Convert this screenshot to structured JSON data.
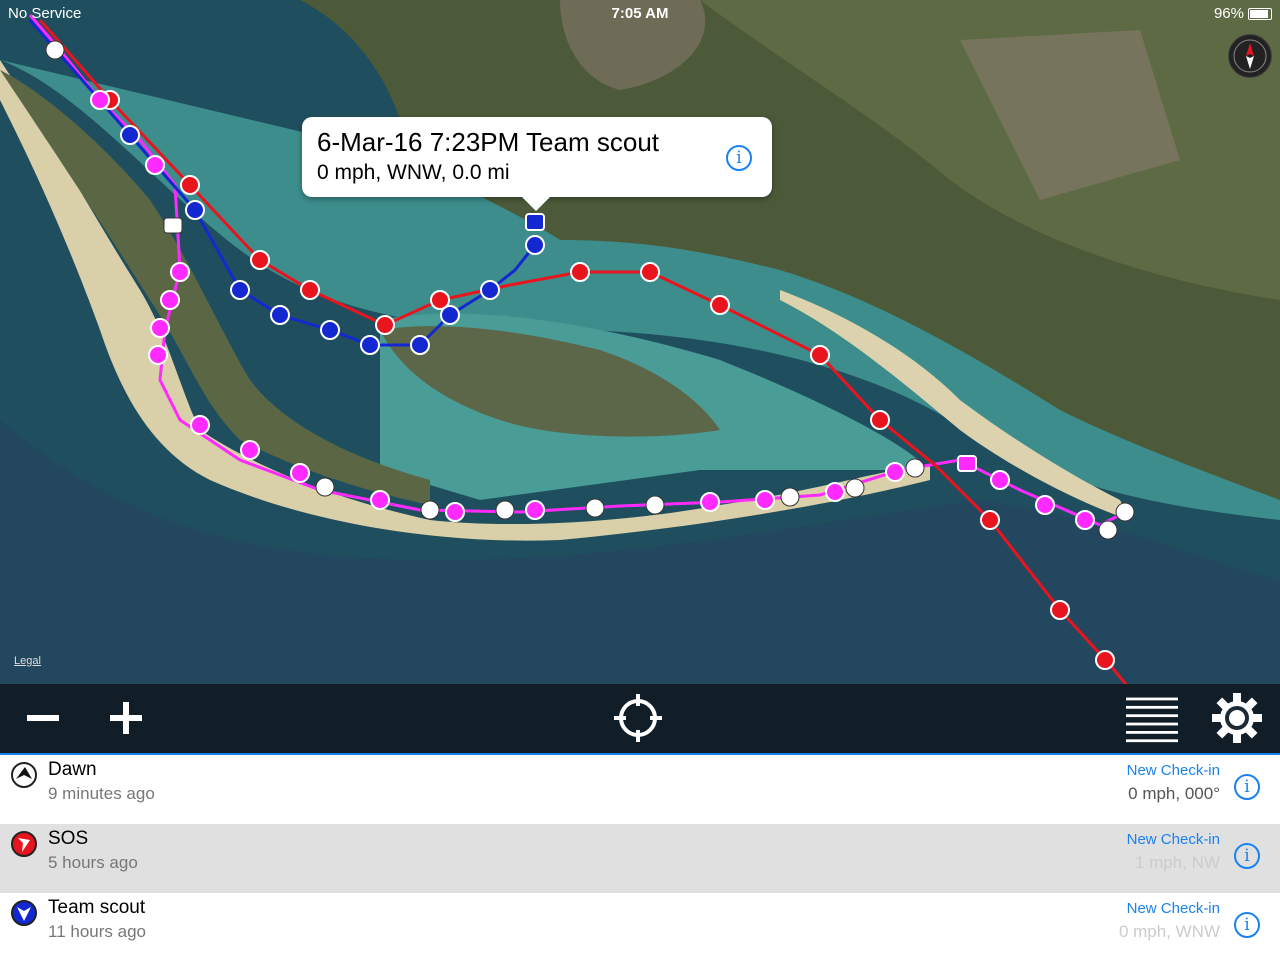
{
  "status_bar": {
    "carrier": "No Service",
    "time": "7:05 AM",
    "battery": "96%"
  },
  "map": {
    "legal": "Legal",
    "callout": {
      "title": "6-Mar-16 7:23PM Team scout",
      "subtitle": "0 mph, WNW, 0.0 mi"
    },
    "colors": {
      "sos_track": "#e8141e",
      "team_scout_track": "#1428d2",
      "dawn_track": "#ff2aff"
    }
  },
  "toolbar": {
    "zoom_out": "minus-icon",
    "zoom_in": "plus-icon",
    "locate": "crosshair-icon",
    "list": "list-icon",
    "settings": "gear-icon"
  },
  "list": {
    "rows": [
      {
        "name": "Dawn",
        "ago": "9 minutes ago",
        "checkin": "New Check-in",
        "speed": "0 mph, 000°",
        "icon": "dawn-marker-icon"
      },
      {
        "name": "SOS",
        "ago": "5 hours ago",
        "checkin": "New Check-in",
        "speed": "1 mph, NW",
        "icon": "sos-marker-icon"
      },
      {
        "name": "Team scout",
        "ago": "11 hours ago",
        "checkin": "New Check-in",
        "speed": "0 mph, WNW",
        "icon": "team-scout-marker-icon"
      }
    ]
  }
}
